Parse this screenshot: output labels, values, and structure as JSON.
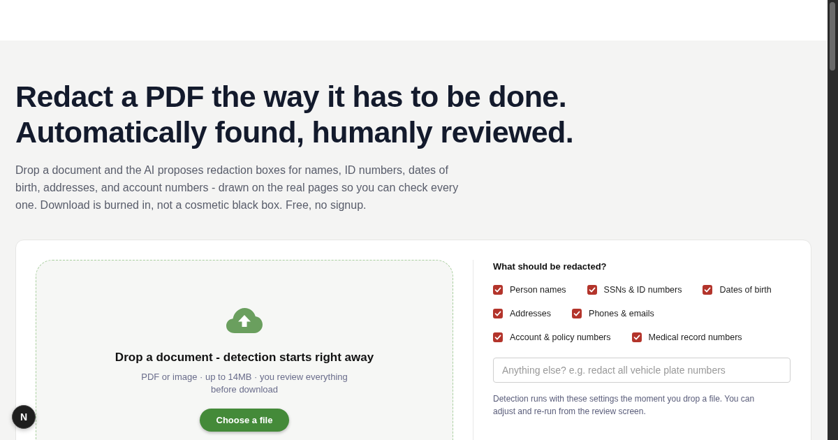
{
  "headline": [
    "Redact a PDF the way it has to be done.",
    "Automatically found, humanly reviewed."
  ],
  "intro": "Drop a document and the AI proposes redaction boxes for names, ID numbers, dates of birth, addresses, and account numbers - drawn on the real pages so you can check every one. Download is burned in, not a cosmetic black box. Free, no signup.",
  "upload": {
    "title": "Drop a document - detection starts right away",
    "hint": "PDF or image · up to 14MB · you review everything before download",
    "button": "Choose a file"
  },
  "options": {
    "title": "What should be redacted?",
    "categories": [
      {
        "label": "Person names",
        "checked": true
      },
      {
        "label": "SSNs & ID numbers",
        "checked": true
      },
      {
        "label": "Dates of birth",
        "checked": true
      },
      {
        "label": "Addresses",
        "checked": true
      },
      {
        "label": "Phones & emails",
        "checked": true
      },
      {
        "label": "Account & policy numbers",
        "checked": true
      },
      {
        "label": "Medical record numbers",
        "checked": true
      }
    ],
    "instructions": {
      "placeholder": "Anything else? e.g. redact all vehicle plate numbers"
    },
    "note": "Detection runs with these settings the moment you drop a file. You can adjust and re-run from the review screen."
  },
  "dev_badge": {
    "label": "N"
  }
}
